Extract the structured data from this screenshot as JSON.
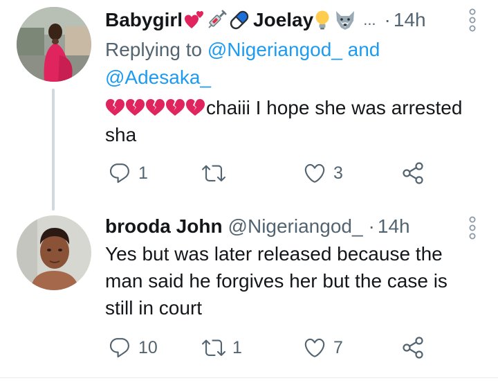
{
  "tweets": [
    {
      "name": "Babygirl",
      "name_2": "Joelay",
      "ellipsis": "...",
      "separator": "·",
      "time": "14h",
      "replying_prefix": "Replying to",
      "reply_mention_1": "@Nigeriangod_",
      "replying_and": "and",
      "reply_mention_2": "@Adesaka_",
      "text_line_1": "chaiii I hope she was arrested",
      "text_line_2": "sha",
      "name_emojis": [
        "two-hearts",
        "syringe",
        "pill",
        "light-bulb",
        "wolf-face"
      ],
      "text_emoji": "broken-heart",
      "text_emoji_count": 5,
      "reply_count": "1",
      "retweet_count": "",
      "like_count": "3"
    },
    {
      "name": "brooda John",
      "handle": "@Nigeriangod_",
      "separator": "·",
      "time": "14h",
      "text_line_1": "Yes but was later released because the",
      "text_line_2": "man said he forgives her but the case is",
      "text_line_3": "still in court",
      "reply_count": "10",
      "retweet_count": "1",
      "like_count": "7"
    }
  ],
  "colors": {
    "text": "#14171a",
    "secondary": "#536471",
    "link": "#1d9bf0",
    "heart_pink": "#e0245e",
    "thread_line": "#cfd9de"
  }
}
